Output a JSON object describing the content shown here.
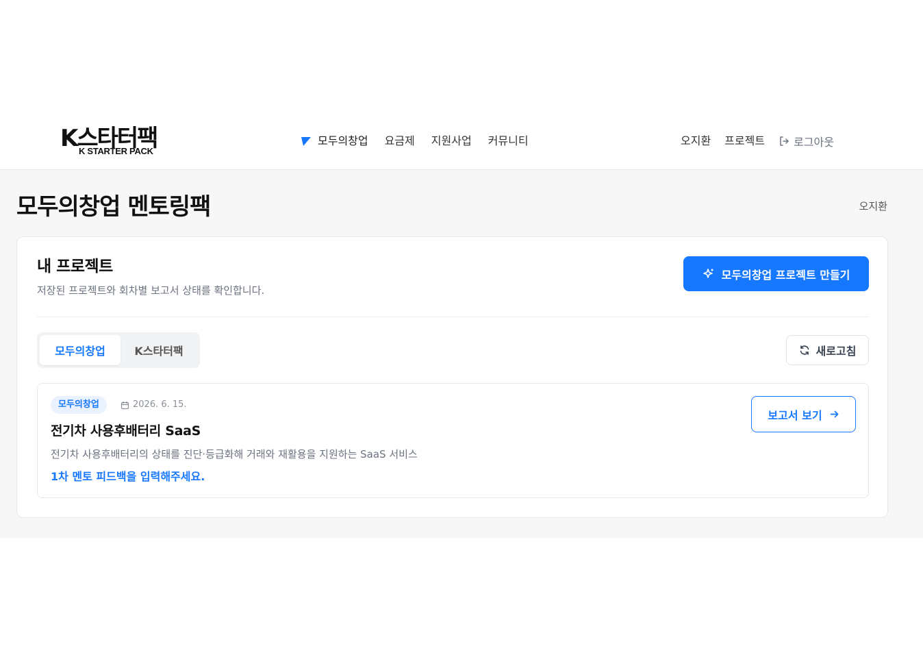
{
  "header": {
    "logo": {
      "main": "K스타터팩",
      "sub": "K STARTER PACK"
    },
    "nav": [
      {
        "label": "모두의창업"
      },
      {
        "label": "요금제"
      },
      {
        "label": "지원사업"
      },
      {
        "label": "커뮤니티"
      }
    ],
    "user_name": "오지환",
    "projects_link": "프로젝트",
    "logout_label": "로그아웃",
    "flag_icon": "flag-icon",
    "logout_icon": "logout-icon"
  },
  "page": {
    "title": "모두의창업 멘토링팩",
    "user_name": "오지환"
  },
  "card": {
    "title": "내 프로젝트",
    "subtitle": "저장된 프로젝트와 회차별 보고서 상태를 확인합니다.",
    "create_button": "모두의창업 프로젝트 만들기",
    "create_icon": "sparkle-icon",
    "tabs": [
      {
        "label": "모두의창업",
        "active": true
      },
      {
        "label": "K스타터팩",
        "active": false
      }
    ],
    "refresh_button": "새로고침",
    "refresh_icon": "refresh-icon"
  },
  "projects": [
    {
      "badge": "모두의창업",
      "date": "2026. 6. 15.",
      "title": "전기차 사용후배터리 SaaS",
      "description": "전기차 사용후배터리의 상태를 진단·등급화해 거래와 재활용을 지원하는 SaaS 서비스",
      "feedback": "1차 멘토 피드백을 입력해주세요.",
      "report_button": "보고서 보기"
    }
  ],
  "colors": {
    "primary": "#1677ff",
    "badge_bg": "#eaf2ff",
    "page_bg": "#f7f7f8"
  }
}
